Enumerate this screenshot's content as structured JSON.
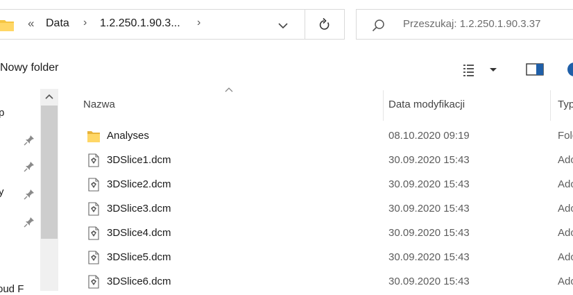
{
  "address_bar": {
    "overflow_glyph": "«",
    "crumbs": [
      "Data",
      "1.2.250.1.90.3..."
    ],
    "separator": "›"
  },
  "search": {
    "placeholder": "Przeszukaj: 1.2.250.1.90.3.37"
  },
  "toolbar": {
    "new_folder_label": "Nowy folder"
  },
  "nav": {
    "fragments": [
      "p",
      "y",
      "oud F"
    ]
  },
  "columns": {
    "name": "Nazwa",
    "date": "Data modyfikacji",
    "type": "Typ"
  },
  "files": [
    {
      "name": "Analyses",
      "date": "08.10.2020 09:19",
      "type": "Folder plików",
      "icon": "folder-icon"
    },
    {
      "name": "3DSlice1.dcm",
      "date": "30.09.2020 15:43",
      "type": "Adobe",
      "icon": "dicom-file-icon"
    },
    {
      "name": "3DSlice2.dcm",
      "date": "30.09.2020 15:43",
      "type": "Adobe",
      "icon": "dicom-file-icon"
    },
    {
      "name": "3DSlice3.dcm",
      "date": "30.09.2020 15:43",
      "type": "Adobe",
      "icon": "dicom-file-icon"
    },
    {
      "name": "3DSlice4.dcm",
      "date": "30.09.2020 15:43",
      "type": "Adobe",
      "icon": "dicom-file-icon"
    },
    {
      "name": "3DSlice5.dcm",
      "date": "30.09.2020 15:43",
      "type": "Adobe",
      "icon": "dicom-file-icon"
    },
    {
      "name": "3DSlice6.dcm",
      "date": "30.09.2020 15:43",
      "type": "Adobe",
      "icon": "dicom-file-icon"
    }
  ],
  "colors": {
    "folder": "#f5c542",
    "accent": "#1f5fa8",
    "scrollbar_thumb": "#cdcdcd"
  }
}
